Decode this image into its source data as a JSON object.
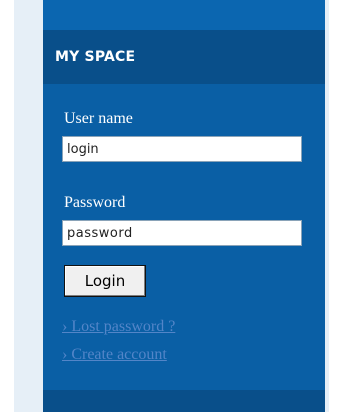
{
  "panel": {
    "title": "MY SPACE"
  },
  "login_form": {
    "username_label": "User name",
    "username_value": "login",
    "password_label": "Password",
    "password_value": "password",
    "login_button": "Login"
  },
  "links": {
    "lost_password": "› Lost password ?",
    "create_account": "› Create account"
  },
  "colors": {
    "panel_bg": "#0a5fa5",
    "header_bg": "#094f8a",
    "link": "#5385c8",
    "page_bg": "#e6eff7"
  }
}
